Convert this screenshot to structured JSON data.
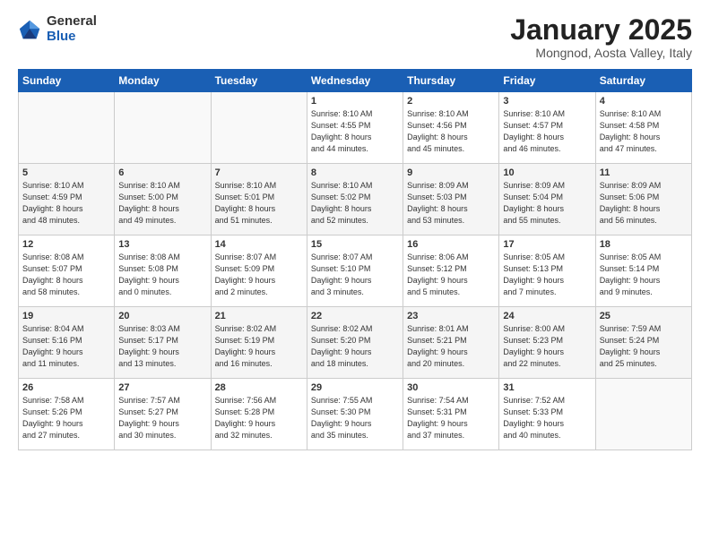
{
  "logo": {
    "general": "General",
    "blue": "Blue"
  },
  "title": "January 2025",
  "subtitle": "Mongnod, Aosta Valley, Italy",
  "weekdays": [
    "Sunday",
    "Monday",
    "Tuesday",
    "Wednesday",
    "Thursday",
    "Friday",
    "Saturday"
  ],
  "weeks": [
    [
      {
        "day": "",
        "info": ""
      },
      {
        "day": "",
        "info": ""
      },
      {
        "day": "",
        "info": ""
      },
      {
        "day": "1",
        "info": "Sunrise: 8:10 AM\nSunset: 4:55 PM\nDaylight: 8 hours\nand 44 minutes."
      },
      {
        "day": "2",
        "info": "Sunrise: 8:10 AM\nSunset: 4:56 PM\nDaylight: 8 hours\nand 45 minutes."
      },
      {
        "day": "3",
        "info": "Sunrise: 8:10 AM\nSunset: 4:57 PM\nDaylight: 8 hours\nand 46 minutes."
      },
      {
        "day": "4",
        "info": "Sunrise: 8:10 AM\nSunset: 4:58 PM\nDaylight: 8 hours\nand 47 minutes."
      }
    ],
    [
      {
        "day": "5",
        "info": "Sunrise: 8:10 AM\nSunset: 4:59 PM\nDaylight: 8 hours\nand 48 minutes."
      },
      {
        "day": "6",
        "info": "Sunrise: 8:10 AM\nSunset: 5:00 PM\nDaylight: 8 hours\nand 49 minutes."
      },
      {
        "day": "7",
        "info": "Sunrise: 8:10 AM\nSunset: 5:01 PM\nDaylight: 8 hours\nand 51 minutes."
      },
      {
        "day": "8",
        "info": "Sunrise: 8:10 AM\nSunset: 5:02 PM\nDaylight: 8 hours\nand 52 minutes."
      },
      {
        "day": "9",
        "info": "Sunrise: 8:09 AM\nSunset: 5:03 PM\nDaylight: 8 hours\nand 53 minutes."
      },
      {
        "day": "10",
        "info": "Sunrise: 8:09 AM\nSunset: 5:04 PM\nDaylight: 8 hours\nand 55 minutes."
      },
      {
        "day": "11",
        "info": "Sunrise: 8:09 AM\nSunset: 5:06 PM\nDaylight: 8 hours\nand 56 minutes."
      }
    ],
    [
      {
        "day": "12",
        "info": "Sunrise: 8:08 AM\nSunset: 5:07 PM\nDaylight: 8 hours\nand 58 minutes."
      },
      {
        "day": "13",
        "info": "Sunrise: 8:08 AM\nSunset: 5:08 PM\nDaylight: 9 hours\nand 0 minutes."
      },
      {
        "day": "14",
        "info": "Sunrise: 8:07 AM\nSunset: 5:09 PM\nDaylight: 9 hours\nand 2 minutes."
      },
      {
        "day": "15",
        "info": "Sunrise: 8:07 AM\nSunset: 5:10 PM\nDaylight: 9 hours\nand 3 minutes."
      },
      {
        "day": "16",
        "info": "Sunrise: 8:06 AM\nSunset: 5:12 PM\nDaylight: 9 hours\nand 5 minutes."
      },
      {
        "day": "17",
        "info": "Sunrise: 8:05 AM\nSunset: 5:13 PM\nDaylight: 9 hours\nand 7 minutes."
      },
      {
        "day": "18",
        "info": "Sunrise: 8:05 AM\nSunset: 5:14 PM\nDaylight: 9 hours\nand 9 minutes."
      }
    ],
    [
      {
        "day": "19",
        "info": "Sunrise: 8:04 AM\nSunset: 5:16 PM\nDaylight: 9 hours\nand 11 minutes."
      },
      {
        "day": "20",
        "info": "Sunrise: 8:03 AM\nSunset: 5:17 PM\nDaylight: 9 hours\nand 13 minutes."
      },
      {
        "day": "21",
        "info": "Sunrise: 8:02 AM\nSunset: 5:19 PM\nDaylight: 9 hours\nand 16 minutes."
      },
      {
        "day": "22",
        "info": "Sunrise: 8:02 AM\nSunset: 5:20 PM\nDaylight: 9 hours\nand 18 minutes."
      },
      {
        "day": "23",
        "info": "Sunrise: 8:01 AM\nSunset: 5:21 PM\nDaylight: 9 hours\nand 20 minutes."
      },
      {
        "day": "24",
        "info": "Sunrise: 8:00 AM\nSunset: 5:23 PM\nDaylight: 9 hours\nand 22 minutes."
      },
      {
        "day": "25",
        "info": "Sunrise: 7:59 AM\nSunset: 5:24 PM\nDaylight: 9 hours\nand 25 minutes."
      }
    ],
    [
      {
        "day": "26",
        "info": "Sunrise: 7:58 AM\nSunset: 5:26 PM\nDaylight: 9 hours\nand 27 minutes."
      },
      {
        "day": "27",
        "info": "Sunrise: 7:57 AM\nSunset: 5:27 PM\nDaylight: 9 hours\nand 30 minutes."
      },
      {
        "day": "28",
        "info": "Sunrise: 7:56 AM\nSunset: 5:28 PM\nDaylight: 9 hours\nand 32 minutes."
      },
      {
        "day": "29",
        "info": "Sunrise: 7:55 AM\nSunset: 5:30 PM\nDaylight: 9 hours\nand 35 minutes."
      },
      {
        "day": "30",
        "info": "Sunrise: 7:54 AM\nSunset: 5:31 PM\nDaylight: 9 hours\nand 37 minutes."
      },
      {
        "day": "31",
        "info": "Sunrise: 7:52 AM\nSunset: 5:33 PM\nDaylight: 9 hours\nand 40 minutes."
      },
      {
        "day": "",
        "info": ""
      }
    ]
  ]
}
